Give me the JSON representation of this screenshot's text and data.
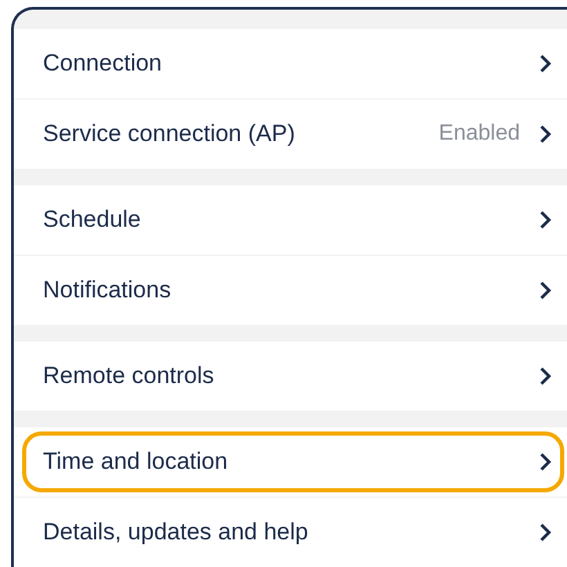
{
  "groups": [
    {
      "items": [
        {
          "label": "Connection",
          "highlighted": false
        },
        {
          "label": "Service connection (AP)",
          "value": "Enabled",
          "highlighted": false
        }
      ]
    },
    {
      "items": [
        {
          "label": "Schedule",
          "highlighted": false
        },
        {
          "label": "Notifications",
          "highlighted": false
        }
      ]
    },
    {
      "items": [
        {
          "label": "Remote controls",
          "highlighted": false
        }
      ]
    },
    {
      "items": [
        {
          "label": "Time and location",
          "highlighted": true
        },
        {
          "label": "Details, updates and help",
          "highlighted": false
        }
      ]
    }
  ]
}
